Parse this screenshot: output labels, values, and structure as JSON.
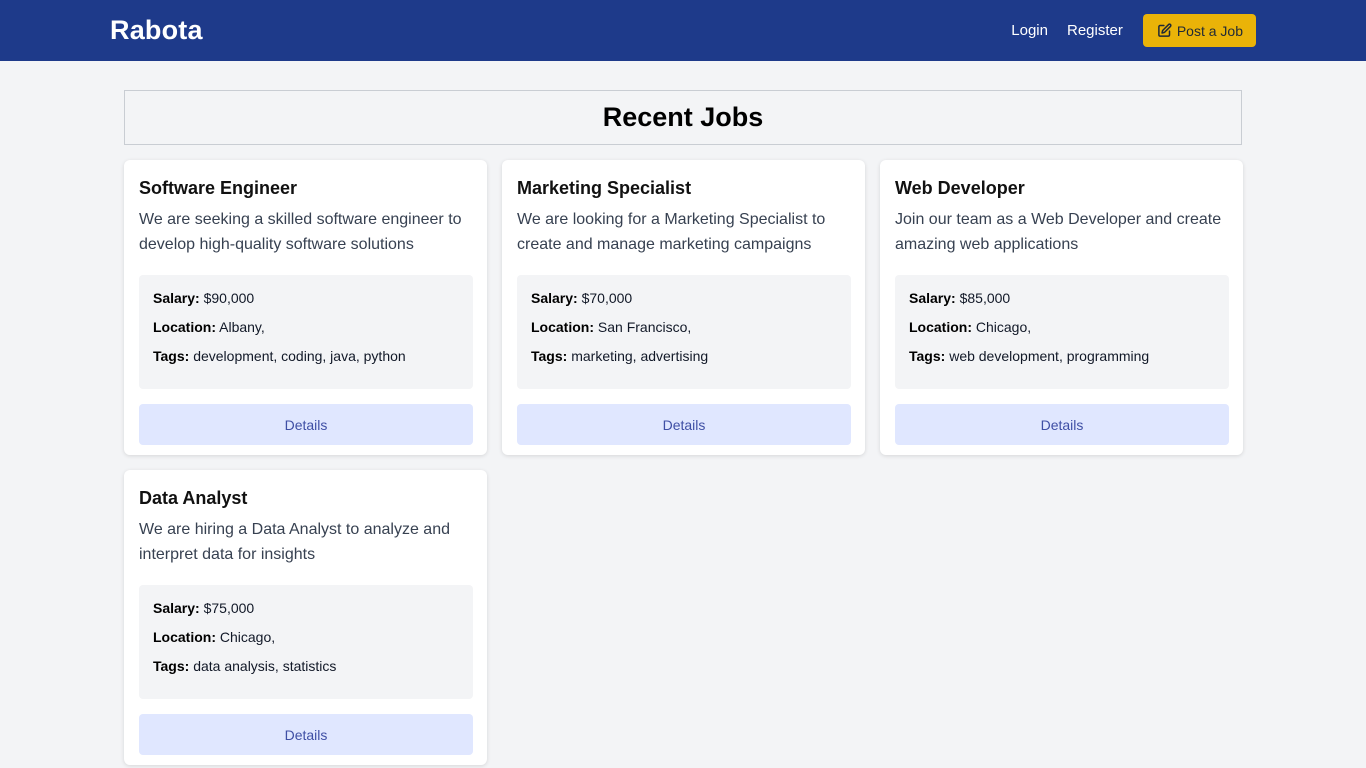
{
  "navbar": {
    "brand": "Rabota",
    "login": "Login",
    "register": "Register",
    "post_job": "Post a Job",
    "post_job_icon": "edit-icon",
    "bg_color": "#1e3a8a",
    "button_color": "#eab308"
  },
  "main": {
    "title": "Recent Jobs"
  },
  "labels": {
    "salary": "Salary:",
    "location": "Location:",
    "tags": "Tags:",
    "details": "Details"
  },
  "jobs": [
    {
      "title": "Software Engineer",
      "description": "We are seeking a skilled software engineer to develop high-quality software solutions",
      "salary": "$90,000",
      "location": "Albany,",
      "tags": "development, coding, java, python"
    },
    {
      "title": "Marketing Specialist",
      "description": "We are looking for a Marketing Specialist to create and manage marketing campaigns",
      "salary": "$70,000",
      "location": "San Francisco,",
      "tags": "marketing, advertising"
    },
    {
      "title": "Web Developer",
      "description": "Join our team as a Web Developer and create amazing web applications",
      "salary": "$85,000",
      "location": "Chicago,",
      "tags": "web development, programming"
    },
    {
      "title": "Data Analyst",
      "description": "We are hiring a Data Analyst to analyze and interpret data for insights",
      "salary": "$75,000",
      "location": "Chicago,",
      "tags": "data analysis, statistics"
    }
  ]
}
